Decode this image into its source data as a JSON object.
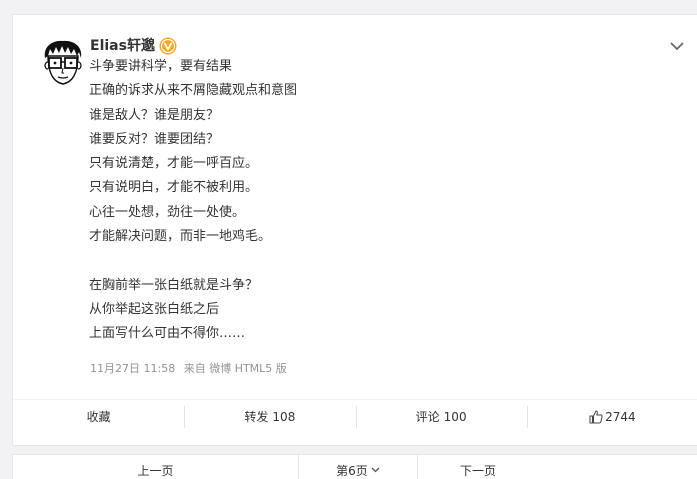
{
  "post": {
    "author": "Elias轩邈",
    "verified_icon": "verified-v-badge-icon",
    "lines": [
      "斗争要讲科学，要有结果",
      "正确的诉求从来不屑隐藏观点和意图",
      "谁是敌人？谁是朋友？",
      "谁要反对？谁要团结？",
      "只有说清楚，才能一呼百应。",
      "只有说明白，才能不被利用。",
      "心往一处想，劲往一处使。",
      "才能解决问题，而非一地鸡毛。",
      "",
      "在胸前举一张白纸就是斗争？",
      "从你举起这张白纸之后",
      "上面写什么可由不得你……"
    ],
    "timestamp": "11月27日 11:58",
    "source": "来自 微博 HTML5 版"
  },
  "actions": {
    "favorite_label": "收藏",
    "repost_label": "转发",
    "repost_count": "108",
    "comment_label": "评论",
    "comment_count": "100",
    "like_count": "2744"
  },
  "pagination": {
    "prev_label": "上一页",
    "current_label": "第6页",
    "next_label": "下一页"
  },
  "colors": {
    "background": "#f2f2f5",
    "card": "#ffffff",
    "meta_text": "#939393",
    "verified_badge": "#f5a623"
  }
}
